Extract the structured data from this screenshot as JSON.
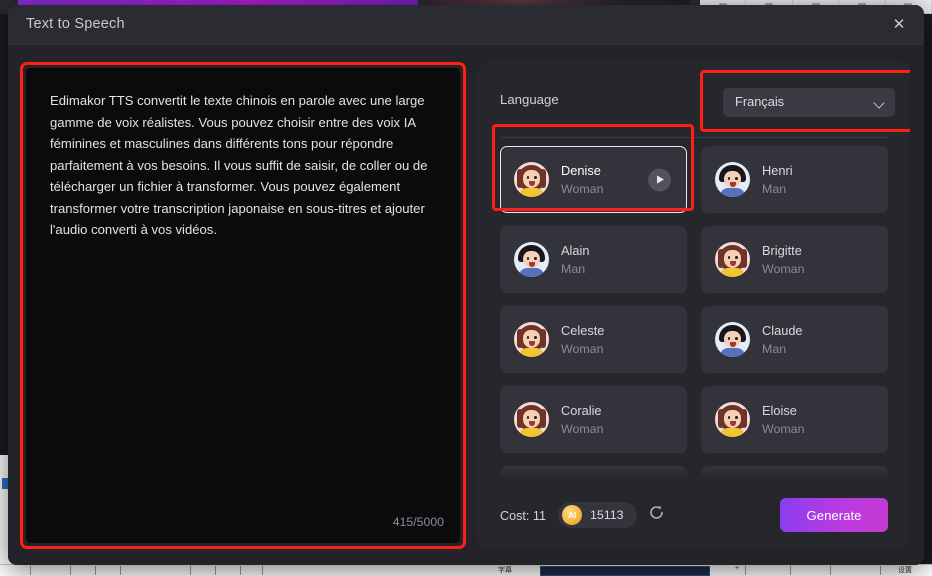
{
  "window": {
    "title": "Text to Speech",
    "close_label": "✕"
  },
  "editor": {
    "text": "Edimakor TTS convertit le texte chinois en parole avec une large gamme de voix réalistes. Vous pouvez choisir entre des voix IA féminines et masculines dans différents tons pour répondre parfaitement à vos besoins. Il vous suffit de saisir, de coller ou de télécharger un fichier à transformer. Vous pouvez également transformer votre transcription japonaise en sous-titres et ajouter l'audio converti à vos vidéos.",
    "placeholder": "",
    "char_count": "415/5000"
  },
  "language": {
    "label": "Language",
    "selected": "Français",
    "chevron": "chevron-down-icon"
  },
  "voices": [
    {
      "name": "Denise",
      "gender": "Woman",
      "selected": true
    },
    {
      "name": "Henri",
      "gender": "Man",
      "selected": false
    },
    {
      "name": "Alain",
      "gender": "Man",
      "selected": false
    },
    {
      "name": "Brigitte",
      "gender": "Woman",
      "selected": false
    },
    {
      "name": "Celeste",
      "gender": "Woman",
      "selected": false
    },
    {
      "name": "Claude",
      "gender": "Man",
      "selected": false
    },
    {
      "name": "Coralie",
      "gender": "Woman",
      "selected": false
    },
    {
      "name": "Eloise",
      "gender": "Woman",
      "selected": false
    },
    {
      "name": "",
      "gender": "",
      "selected": false
    },
    {
      "name": "",
      "gender": "",
      "selected": false
    }
  ],
  "footer": {
    "cost_label": "Cost: 11",
    "coin_label": "AI",
    "credits": "15113",
    "refresh": "refresh-icon",
    "generate_label": "Generate"
  },
  "colors": {
    "accent_purple": "#b93ae0",
    "highlight_red": "#ff1f14",
    "panel_bg": "#26262d",
    "modal_bg": "#232329",
    "editor_bg": "#0b0b0d",
    "coin_gold": "#f5b942"
  }
}
